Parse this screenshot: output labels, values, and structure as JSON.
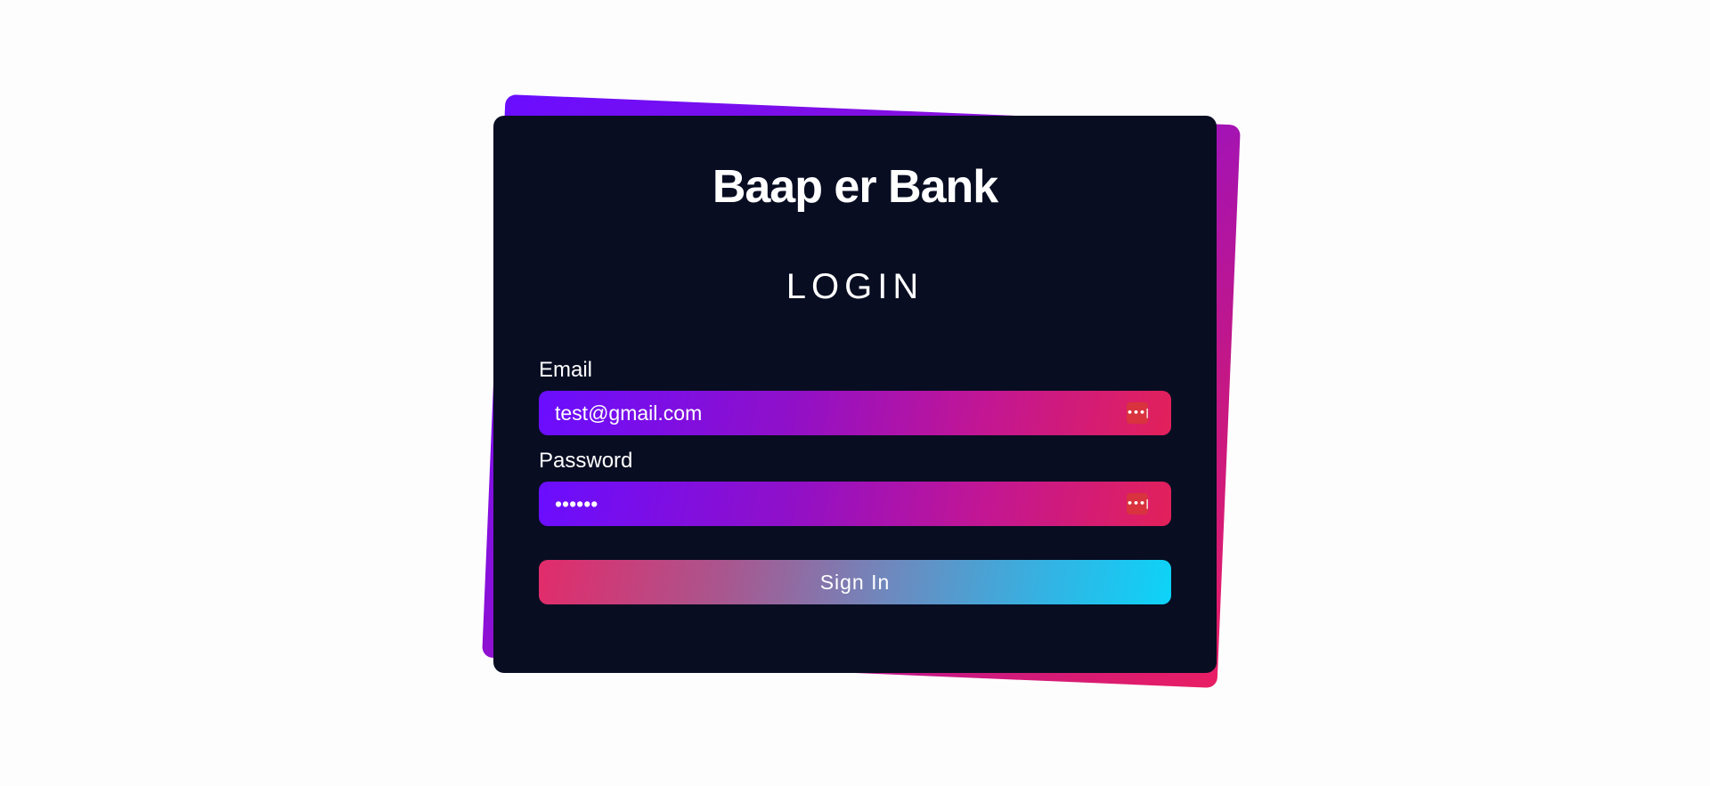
{
  "app": {
    "title": "Baap er Bank"
  },
  "login": {
    "heading": "LOGIN",
    "email_label": "Email",
    "email_value": "test@gmail.com",
    "password_label": "Password",
    "password_value": "123456",
    "password_manager_icon": "•••|",
    "signin_label": "Sign In"
  },
  "colors": {
    "page_background": "#fdfdfd",
    "card_background": "#080d22",
    "backdrop_gradient_start": "#6a0dff",
    "backdrop_gradient_end": "#e91e63",
    "button_gradient_start": "#e22b6a",
    "button_gradient_end": "#0dd3f8",
    "text": "#ffffff"
  },
  "icons": {
    "email_field_icon": "password-manager-icon",
    "password_field_icon": "password-manager-icon"
  }
}
